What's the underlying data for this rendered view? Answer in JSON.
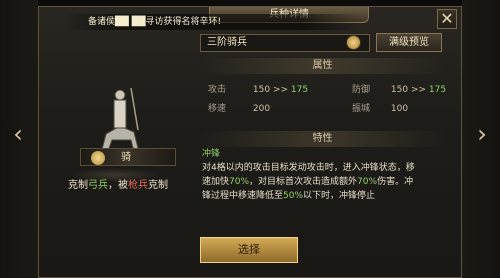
{
  "window": {
    "title": "兵种详情",
    "close_glyph": "✕"
  },
  "notice": {
    "text": "备诸侯██ ██寻访获得名将辛环!"
  },
  "unit": {
    "name": "三阶骑兵",
    "type_label": "骑",
    "counter": {
      "prefix": "克制",
      "strong_against": "弓兵",
      "mid": "，被",
      "weak_against": "枪兵",
      "suffix": "克制"
    }
  },
  "buttons": {
    "max_preview": "满级预览",
    "select": "选择"
  },
  "attributes": {
    "header": "属性",
    "attack": {
      "label": "攻击",
      "value": "150",
      "arrow": ">>",
      "next": "175"
    },
    "defense": {
      "label": "防御",
      "value": "150",
      "arrow": ">>",
      "next": "175"
    },
    "speed": {
      "label": "移速",
      "value": "200"
    },
    "siege": {
      "label": "振城",
      "value": "100"
    }
  },
  "traits": {
    "header": "特性",
    "title": "冲锋",
    "line1": "对4格以内的攻击目标发动攻击时，进入冲锋状态，移",
    "line2a": "速加快",
    "line2b": "70%",
    "line2c": "，对目标首次攻击造成额外",
    "line2d": "70%",
    "line2e": "伤害。冲",
    "line3a": "锋过程中移速降低至",
    "line3b": "50%",
    "line3c": "以下时，冲锋停止"
  },
  "nav": {
    "left": "‹",
    "right": "›"
  },
  "colors": {
    "accent_green": "#8ed16a",
    "accent_red": "#e06a55",
    "gold": "#d3aa56"
  }
}
